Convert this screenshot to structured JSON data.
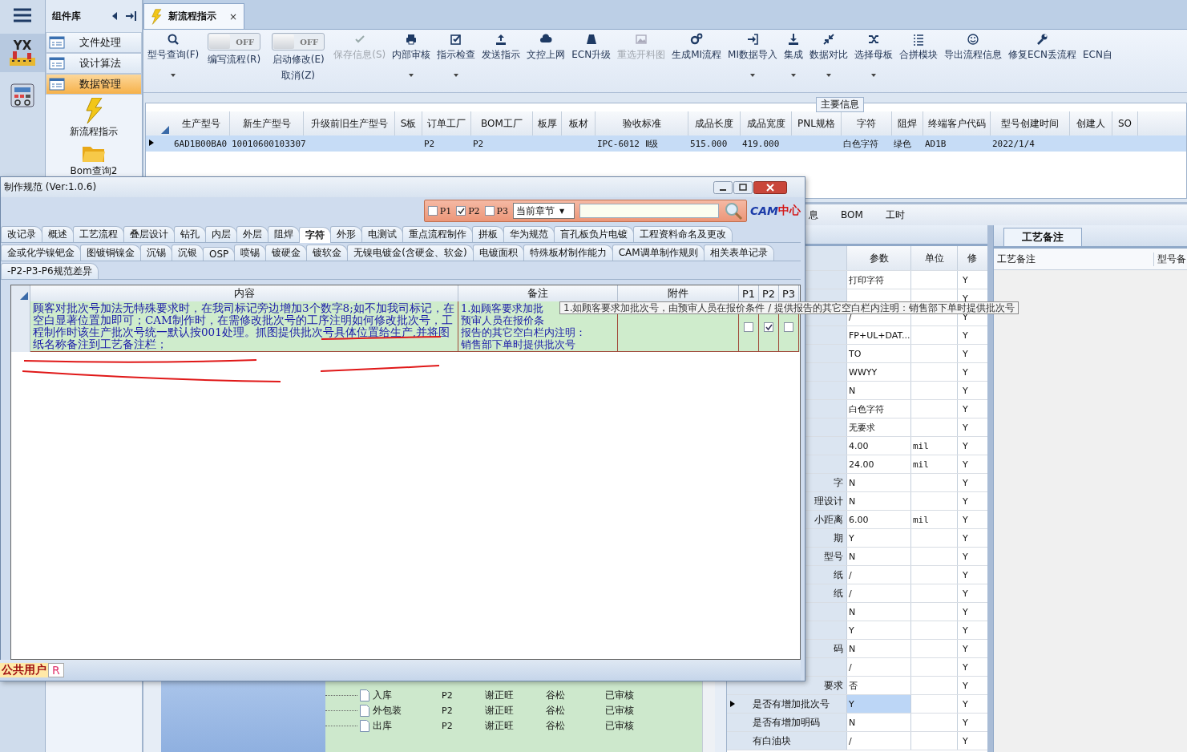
{
  "rail": {
    "logo_text": "YX"
  },
  "component_panel": {
    "title": "组件库",
    "items": [
      {
        "label": "文件处理",
        "selected": false
      },
      {
        "label": "设计算法",
        "selected": false
      },
      {
        "label": "数据管理",
        "selected": true
      }
    ],
    "tools": [
      {
        "label": "新流程指示"
      },
      {
        "label": "Bom查询2"
      }
    ]
  },
  "doc_tab": {
    "title": "新流程指示",
    "close": "×"
  },
  "toolbar": [
    {
      "kind": "button",
      "label": "型号查询(F)",
      "disabled": false,
      "dropdown": true
    },
    {
      "kind": "switch",
      "switch_text": "OFF",
      "on": false,
      "labels": [
        "编写流程(R)"
      ]
    },
    {
      "kind": "switch",
      "switch_text": "OFF",
      "on": false,
      "labels": [
        "启动修改(E)",
        "取消(Z)"
      ]
    },
    {
      "kind": "button",
      "label": "保存信息(S)",
      "disabled": true,
      "dropdown": false
    },
    {
      "kind": "button",
      "label": "内部审核",
      "disabled": false,
      "dropdown": true
    },
    {
      "kind": "button",
      "label": "指示检查",
      "disabled": false,
      "dropdown": true
    },
    {
      "kind": "button",
      "label": "发送指示",
      "disabled": false,
      "dropdown": false
    },
    {
      "kind": "button",
      "label": "文控上网",
      "disabled": false,
      "dropdown": false
    },
    {
      "kind": "button",
      "label": "ECN升级",
      "disabled": false,
      "dropdown": false
    },
    {
      "kind": "button",
      "label": "重选开料图",
      "disabled": true,
      "dropdown": false
    },
    {
      "kind": "button",
      "label": "生成MI流程",
      "disabled": false,
      "dropdown": false
    },
    {
      "kind": "button",
      "label": "MI数据导入",
      "disabled": false,
      "dropdown": true
    },
    {
      "kind": "button",
      "label": "集成",
      "disabled": false,
      "dropdown": true
    },
    {
      "kind": "button",
      "label": "数据对比",
      "disabled": false,
      "dropdown": true
    },
    {
      "kind": "button",
      "label": "选择母板",
      "disabled": false,
      "dropdown": true
    },
    {
      "kind": "button",
      "label": "合拼模块",
      "disabled": false,
      "dropdown": false
    },
    {
      "kind": "button",
      "label": "导出流程信息",
      "disabled": false,
      "dropdown": false
    },
    {
      "kind": "button",
      "label": "修复ECN丢流程",
      "disabled": false,
      "dropdown": false
    },
    {
      "kind": "button",
      "label": "ECN自",
      "disabled": false,
      "dropdown": false
    }
  ],
  "main_group": {
    "title": "主要信息",
    "columns": [
      "生产型号",
      "新生产型号",
      "升级前旧生产型号",
      "S板",
      "订单工厂",
      "BOM工厂",
      "板厚",
      "板材",
      "验收标准",
      "成品长度",
      "成品宽度",
      "PNL规格",
      "字符",
      "阻焊",
      "终端客户代码",
      "型号创建时间",
      "创建人",
      "SO"
    ],
    "rows": [
      {
        "selected": true,
        "cells": [
          "6AD1B00BA0",
          "10010600103307",
          null,
          null,
          "P2",
          "P2",
          null,
          null,
          "IPC-6012 Ⅱ级",
          "515.000",
          "419.000",
          null,
          "白色字符",
          "绿色",
          "AD1B",
          "2022/1/4",
          null,
          null
        ]
      }
    ]
  },
  "lower_tabs": [
    "息",
    "BOM",
    "工时"
  ],
  "params": {
    "columns": [
      "参数",
      "单位",
      "修"
    ],
    "rows": [
      {
        "param": "打印字符",
        "mod": "Y",
        "selected": false
      },
      {
        "mod": "Y",
        "selected": false
      },
      {
        "param": "/",
        "mod": "Y",
        "selected": false
      },
      {
        "param": "FP+UL+DAT...",
        "mod": "Y",
        "selected": false
      },
      {
        "param": "TO",
        "mod": "Y",
        "selected": false
      },
      {
        "param": "WWYY",
        "mod": "Y",
        "selected": false
      },
      {
        "param": "N",
        "mod": "Y",
        "selected": false
      },
      {
        "param": "白色字符",
        "mod": "Y",
        "selected": false
      },
      {
        "param": "无要求",
        "mod": "Y",
        "selected": false
      },
      {
        "param": "4.00",
        "unit": "mil",
        "mod": "Y",
        "selected": false
      },
      {
        "param": "24.00",
        "unit": "mil",
        "mod": "Y",
        "selected": false
      },
      {
        "name": "字",
        "param": "N",
        "mod": "Y",
        "selected": false
      },
      {
        "name": "理设计",
        "param": "N",
        "mod": "Y",
        "selected": false
      },
      {
        "name": "小距离",
        "param": "6.00",
        "unit": "mil",
        "mod": "Y",
        "selected": false
      },
      {
        "name": "期",
        "param": "Y",
        "mod": "Y",
        "selected": false
      },
      {
        "name": "型号",
        "param": "N",
        "mod": "Y",
        "selected": false
      },
      {
        "name": "纸",
        "param": "/",
        "mod": "Y",
        "selected": false
      },
      {
        "name": "纸",
        "param": "/",
        "mod": "Y",
        "selected": false
      },
      {
        "param": "N",
        "mod": "Y",
        "selected": false
      },
      {
        "param": "Y",
        "mod": "Y",
        "selected": false
      },
      {
        "name": "码",
        "param": "N",
        "mod": "Y",
        "selected": false
      },
      {
        "param": "/",
        "mod": "Y",
        "selected": false
      },
      {
        "name": "要求",
        "param": "否",
        "mod": "Y",
        "selected": false
      },
      {
        "name": "是否有增加批次号",
        "param": "Y",
        "mod": "Y",
        "selected": true
      },
      {
        "name": "是否有增加明码",
        "param": "N",
        "mod": "Y",
        "selected": false
      },
      {
        "name": "有白油块",
        "param": "/",
        "mod": "Y",
        "selected": false
      }
    ]
  },
  "remark_panel": {
    "tab": "工艺备注",
    "columns": [
      "工艺备注",
      "型号备"
    ]
  },
  "tree": [
    {
      "name": "入库",
      "factory": "P2",
      "maker": "谢正旺",
      "reviewer": "谷松",
      "status": "已审核"
    },
    {
      "name": "外包装",
      "factory": "P2",
      "maker": "谢正旺",
      "reviewer": "谷松",
      "status": "已审核"
    },
    {
      "name": "出库",
      "factory": "P2",
      "maker": "谢正旺",
      "reviewer": "谷松",
      "status": "已审核"
    }
  ],
  "dialog": {
    "title": "制作规范 (Ver:1.0.6)",
    "filters": [
      {
        "label": "P1",
        "checked": false
      },
      {
        "label": "P2",
        "checked": true
      },
      {
        "label": "P3",
        "checked": false
      }
    ],
    "scope": "当前章节",
    "scope_arrow": "▼",
    "logo": [
      "CAM",
      "中心"
    ],
    "tab_rows": [
      [
        {
          "label": "改记录",
          "selected": false
        },
        {
          "label": "概述",
          "selected": false
        },
        {
          "label": "工艺流程",
          "selected": false
        },
        {
          "label": "叠层设计",
          "selected": false
        },
        {
          "label": "钻孔",
          "selected": false
        },
        {
          "label": "内层",
          "selected": false
        },
        {
          "label": "外层",
          "selected": false
        },
        {
          "label": "阻焊",
          "selected": false
        },
        {
          "label": "字符",
          "selected": true
        },
        {
          "label": "外形",
          "selected": false
        },
        {
          "label": "电测试",
          "selected": false
        },
        {
          "label": "重点流程制作",
          "selected": false
        },
        {
          "label": "拼板",
          "selected": false
        },
        {
          "label": "华为规范",
          "selected": false
        },
        {
          "label": "盲孔板负片电镀",
          "selected": false
        },
        {
          "label": "工程资料命名及更改",
          "selected": false
        }
      ],
      [
        {
          "label": "金或化学镍钯金",
          "selected": false
        },
        {
          "label": "图镀铜镍金",
          "selected": false
        },
        {
          "label": "沉锡",
          "selected": false
        },
        {
          "label": "沉银",
          "selected": false
        },
        {
          "label": "OSP",
          "selected": false
        },
        {
          "label": "喷锡",
          "selected": false
        },
        {
          "label": "镀硬金",
          "selected": false
        },
        {
          "label": "镀软金",
          "selected": false
        },
        {
          "label": "无镍电镀金(含硬金、软金)",
          "selected": false
        },
        {
          "label": "电镀面积",
          "selected": false
        },
        {
          "label": "特殊板材制作能力",
          "selected": false
        },
        {
          "label": "CAM调单制作规则",
          "selected": false
        },
        {
          "label": "相关表单记录",
          "selected": false
        }
      ],
      [
        {
          "label": "-P2-P3-P6规范差异",
          "selected": false
        }
      ]
    ],
    "columns": [
      "内容",
      "备注",
      "附件",
      "P1",
      "P2",
      "P3"
    ],
    "rows": [
      {
        "content": "顾客对批次号加法无特殊要求时，在我司标记旁边增加3个数字8;如不加我司标记，在空白显著位置加即可；CAM制作时，在需修改批次号的工序注明如何修改批次号，工程制作时该生产批次号统一默认按001处理。抓图提供批次号具体位置给生产,并将图纸名称备注到工艺备注栏；",
        "remark_lines": [
          "1.如顾客要求加批",
          "预审人员在报价条",
          "报告的其它空白栏内注明：",
          "销售部下单时提供批次号"
        ],
        "p1": false,
        "p2": true,
        "p3": false
      }
    ],
    "tooltip": "1.如顾客要求加批次号，由预审人员在报价条件 / 提供报告的其它空白栏内注明：销售部下单时提供批次号",
    "status": [
      "公共用户",
      "R"
    ]
  }
}
